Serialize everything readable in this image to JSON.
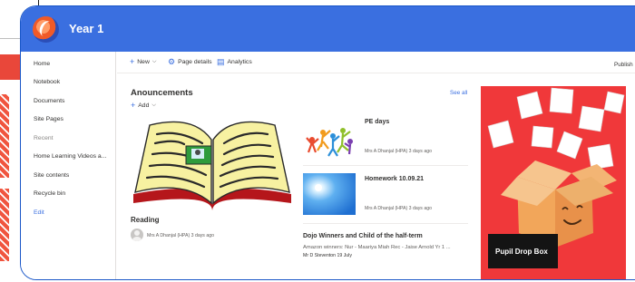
{
  "site": {
    "title": "Year 1"
  },
  "leftnav": {
    "items": [
      {
        "label": "Home"
      },
      {
        "label": "Notebook"
      },
      {
        "label": "Documents"
      },
      {
        "label": "Site Pages"
      },
      {
        "label": "Recent"
      },
      {
        "label": "Home Learning Videos a..."
      },
      {
        "label": "Site contents"
      },
      {
        "label": "Recycle bin"
      },
      {
        "label": "Edit"
      }
    ]
  },
  "commandbar": {
    "new_label": "New",
    "page_details_label": "Page details",
    "analytics_label": "Analytics",
    "publish_label": "Publish"
  },
  "announcements": {
    "title": "Anouncements",
    "see_all": "See all",
    "add_label": "Add",
    "featured": {
      "title": "Reading",
      "meta": "Mrs A Dhanjal (HPA)  3 days ago"
    },
    "items": [
      {
        "title": "PE days",
        "meta": "Mrs A Dhanjal (HPA)  3 days ago"
      },
      {
        "title": "Homework 10.09.21",
        "meta": "Mrs A Dhanjal (HPA)  3 days ago"
      }
    ],
    "text_item": {
      "title": "Dojo Winners and Child of the half-term",
      "excerpt": "Amazon winners: Nur - Maariya Miah Rec - Jaise Arnold Yr 1 ...",
      "meta": "Mr D Steventon  19 July"
    }
  },
  "promo": {
    "label": "Pupil Drop Box"
  },
  "colors": {
    "header": "#3a6fe0",
    "accent": "#3a6fe0",
    "promo_bg": "#f0383a"
  },
  "icons": [
    "site-logo",
    "plus-icon",
    "gear-icon",
    "analytics-icon",
    "chevron-down-icon",
    "star-icon"
  ]
}
